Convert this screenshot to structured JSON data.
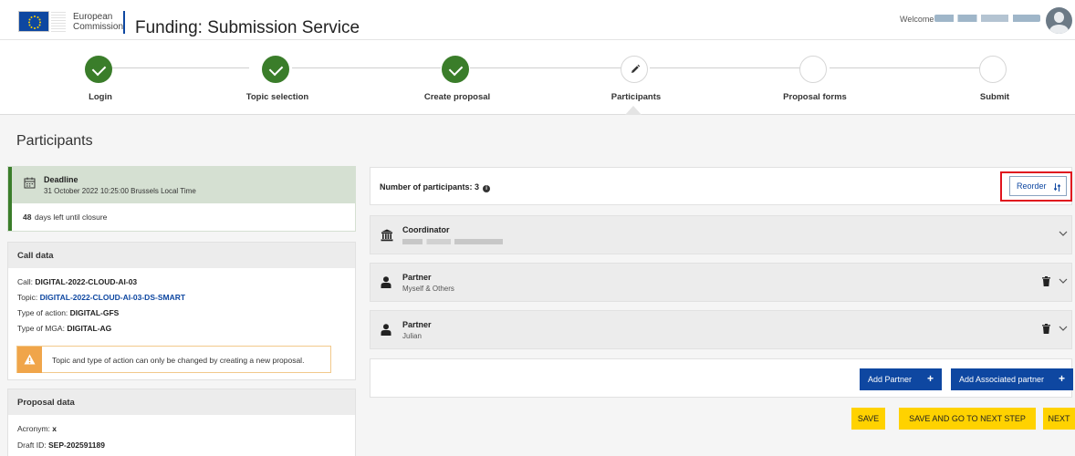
{
  "header": {
    "logo_line1": "European",
    "logo_line2": "Commission",
    "app_title": "Funding: Submission Service",
    "welcome_label": "Welcome"
  },
  "stepper": {
    "steps": [
      {
        "label": "Login",
        "state": "done"
      },
      {
        "label": "Topic selection",
        "state": "done"
      },
      {
        "label": "Create proposal",
        "state": "done"
      },
      {
        "label": "Participants",
        "state": "current"
      },
      {
        "label": "Proposal forms",
        "state": "pending"
      },
      {
        "label": "Submit",
        "state": "pending"
      }
    ]
  },
  "page": {
    "title": "Participants"
  },
  "deadline": {
    "title": "Deadline",
    "date": "31 October 2022 10:25:00 Brussels Local Time",
    "days_left": "48",
    "days_left_text": " days left until closure"
  },
  "call_data": {
    "heading": "Call data",
    "call_label": "Call: ",
    "call_value": "DIGITAL-2022-CLOUD-AI-03",
    "topic_label": "Topic: ",
    "topic_value": "DIGITAL-2022-CLOUD-AI-03-DS-SMART",
    "action_label": "Type of action: ",
    "action_value": "DIGITAL-GFS",
    "mga_label": "Type of MGA: ",
    "mga_value": "DIGITAL-AG",
    "warning": "Topic and type of action can only be changed by creating a new proposal."
  },
  "proposal_data": {
    "heading": "Proposal data",
    "acronym_label": "Acronym: ",
    "acronym_value": "x",
    "draft_label": "Draft ID: ",
    "draft_value": "SEP-202591189"
  },
  "participants": {
    "count_label": "Number of participants: ",
    "count_value": "3",
    "reorder_label": "Reorder",
    "items": [
      {
        "role": "Coordinator",
        "name": ""
      },
      {
        "role": "Partner",
        "name": "Myself & Others"
      },
      {
        "role": "Partner",
        "name": "Julian"
      }
    ],
    "add_partner": "Add Partner",
    "add_associated": "Add Associated partner"
  },
  "actions": {
    "save": "SAVE",
    "save_next": "SAVE AND GO TO NEXT STEP",
    "next": "NEXT"
  },
  "colors": {
    "primary": "#0e47a1",
    "success": "#3a7d2a",
    "warning": "#f0a54a",
    "highlight": "#ffd200",
    "annotation": "#e0141e"
  }
}
